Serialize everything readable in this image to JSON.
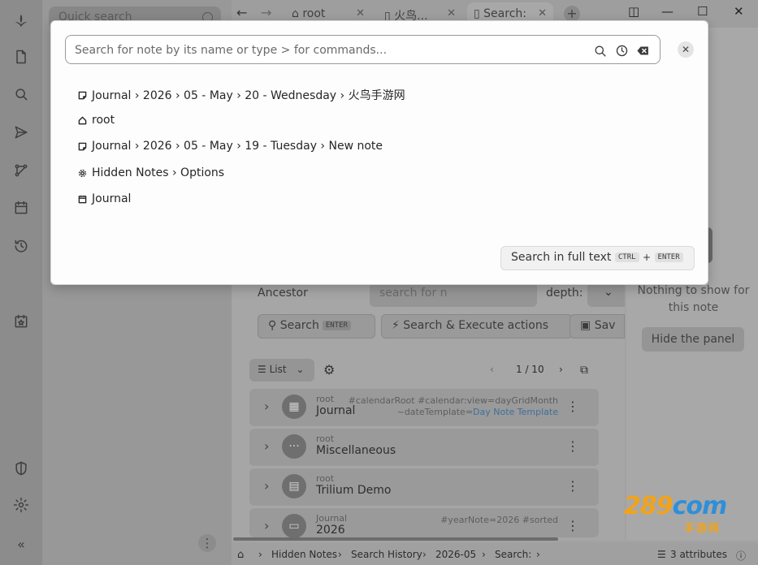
{
  "launcher": {
    "icons": [
      "logo-icon",
      "new-note-icon",
      "search-icon",
      "jump-to-icon",
      "note-map-icon",
      "calendar-icon",
      "recent-changes-icon",
      "today-icon",
      "protected-session-icon",
      "settings-icon",
      "collapse-sidebar-icon"
    ]
  },
  "tree": {
    "quick_search_placeholder": "Quick search"
  },
  "tabs": [
    {
      "label": "root",
      "icon": "home-icon"
    },
    {
      "label": "火鸟...",
      "icon": "note-icon"
    },
    {
      "label": "Search:",
      "icon": "search-note-icon"
    }
  ],
  "search_note": {
    "ancestor_label": "Ancestor",
    "ancestor_placeholder": "search for n",
    "depth_label": "depth:",
    "search_button": "Search",
    "search_kbd": "ENTER",
    "search_execute_button": "Search & Execute actions",
    "save_button": "Sav",
    "view_type": "List",
    "pagination": "1 / 10",
    "results": [
      {
        "path": "root",
        "title": "Journal",
        "icon": "calendar-icon",
        "attrs": "#calendarRoot #calendar:view=dayGridMonth",
        "attrs2_prefix": "~dateTemplate=",
        "attrs2_link": "Day Note Template"
      },
      {
        "path": "root",
        "title": "Miscellaneous",
        "icon": "dots-icon",
        "attrs": "",
        "attrs2_prefix": "",
        "attrs2_link": ""
      },
      {
        "path": "root",
        "title": "Trilium Demo",
        "icon": "book-icon",
        "attrs": "",
        "attrs2_prefix": "",
        "attrs2_link": ""
      },
      {
        "path": "Journal",
        "title": "2026",
        "icon": "folder-icon",
        "attrs": "#yearNote=2026 #sorted",
        "attrs2_prefix": "",
        "attrs2_link": ""
      }
    ]
  },
  "right_panel": {
    "empty_text": "Nothing to show for this note",
    "hide_button": "Hide the panel"
  },
  "status_bar": {
    "breadcrumbs": [
      "Hidden Notes",
      "Search History",
      "2026-05",
      "Search:"
    ],
    "attributes": "3 attributes"
  },
  "jump_dialog": {
    "placeholder": "Search for note by its name or type > for commands...",
    "results": [
      {
        "icon": "note-icon",
        "text": "Journal › 2026 › 05 - May › 20 - Wednesday › 火鸟手游网"
      },
      {
        "icon": "home-icon",
        "text": "root"
      },
      {
        "icon": "note-icon",
        "text": "Journal › 2026 › 05 - May › 19 - Tuesday › New note"
      },
      {
        "icon": "gear-icon",
        "text": "Hidden Notes › Options"
      },
      {
        "icon": "calendar-icon",
        "text": "Journal"
      }
    ],
    "full_text_button": "Search in full text",
    "kbd_ctrl": "CTRL",
    "kbd_plus": "+",
    "kbd_enter": "ENTER"
  },
  "watermark": {
    "text_a": "289",
    "text_b": "com",
    "text_c": "手游网"
  }
}
